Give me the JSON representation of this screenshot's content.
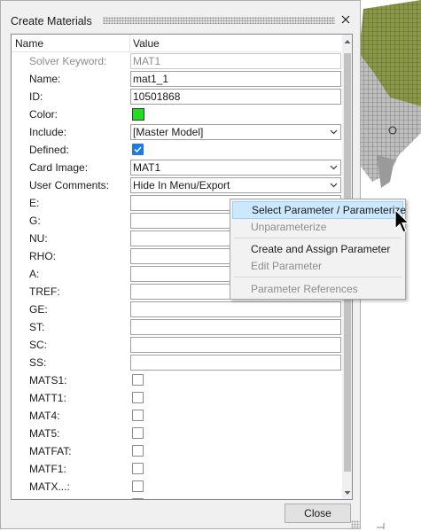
{
  "dialog": {
    "title": "Create Materials",
    "close_button_label": "Close"
  },
  "grid": {
    "headers": {
      "name": "Name",
      "value": "Value"
    },
    "rows": {
      "solver_keyword": {
        "label": "Solver Keyword:",
        "value": "MAT1"
      },
      "name": {
        "label": "Name:",
        "value": "mat1_1"
      },
      "id": {
        "label": "ID:",
        "value": "10501868"
      },
      "color": {
        "label": "Color:",
        "swatch": "#22dd22"
      },
      "include": {
        "label": "Include:",
        "value": "[Master Model]"
      },
      "defined": {
        "label": "Defined:",
        "checked": true
      },
      "card_image": {
        "label": "Card Image:",
        "value": "MAT1"
      },
      "user_comments": {
        "label": "User Comments:",
        "value": "Hide In Menu/Export"
      },
      "e": {
        "label": "E:",
        "value": ""
      },
      "g": {
        "label": "G:",
        "value": ""
      },
      "nu": {
        "label": "NU:",
        "value": ""
      },
      "rho": {
        "label": "RHO:",
        "value": ""
      },
      "a": {
        "label": "A:",
        "value": ""
      },
      "tref": {
        "label": "TREF:",
        "value": ""
      },
      "ge": {
        "label": "GE:",
        "value": ""
      },
      "st": {
        "label": "ST:",
        "value": ""
      },
      "sc": {
        "label": "SC:",
        "value": ""
      },
      "ss": {
        "label": "SS:",
        "value": ""
      },
      "mats1": {
        "label": "MATS1:",
        "checked": false
      },
      "matt1": {
        "label": "MATT1:",
        "checked": false
      },
      "mat4": {
        "label": "MAT4:",
        "checked": false
      },
      "mat5": {
        "label": "MAT5:",
        "checked": false
      },
      "matfat": {
        "label": "MATFAT:",
        "checked": false
      },
      "matf1": {
        "label": "MATF1:",
        "checked": false
      },
      "matx": {
        "label": "MATX...:",
        "checked": false
      }
    }
  },
  "context_menu": {
    "select_parameter": "Select Parameter / Parameterize",
    "unparameterize": "Unparameterize",
    "create_assign": "Create and Assign Parameter",
    "edit_parameter": "Edit Parameter",
    "parameter_references": "Parameter References"
  },
  "colors": {
    "accent": "#1e7be0",
    "menu_highlight": "#cce8ff",
    "mesh_green": "#7a8a3a"
  },
  "icons": {
    "close": "close-icon",
    "dropdown": "chevron-down-icon",
    "checkbox_checked": "check-icon",
    "pointer": "arrow-cursor-icon"
  }
}
